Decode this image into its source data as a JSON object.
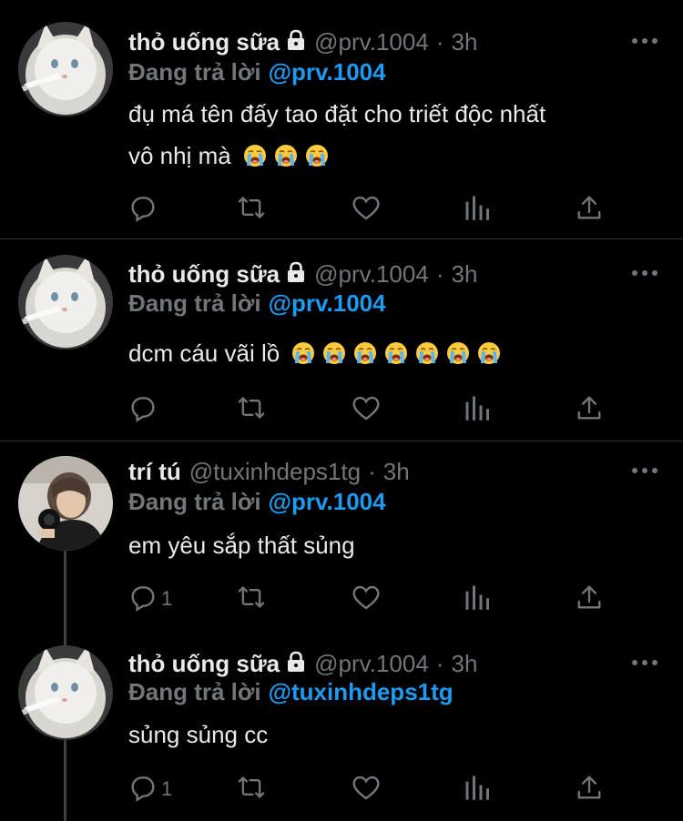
{
  "tweets": [
    {
      "name": "thỏ uống sữa",
      "locked": true,
      "handle": "@prv.1004",
      "dot": "·",
      "time": "3h",
      "reply_prefix": "Đang trả lời",
      "reply_to": "@prv.1004",
      "text_line1": "đụ má tên đấy tao đặt cho triết độc nhất",
      "text_line2": "vô nhị mà",
      "emoji_count": 3,
      "reply_count": "",
      "avatar": "white-cat-smoking"
    },
    {
      "name": "thỏ uống sữa",
      "locked": true,
      "handle": "@prv.1004",
      "dot": "·",
      "time": "3h",
      "reply_prefix": "Đang trả lời",
      "reply_to": "@prv.1004",
      "text_line1": "dcm cáu vãi lồ",
      "text_line2": "",
      "emoji_count": 7,
      "reply_count": "",
      "avatar": "white-cat-smoking"
    },
    {
      "name": "trí tú",
      "locked": false,
      "handle": "@tuxinhdeps1tg",
      "dot": "·",
      "time": "3h",
      "reply_prefix": "Đang trả lời",
      "reply_to": "@prv.1004",
      "text_line1": "em yêu sắp thất sủng",
      "text_line2": "",
      "emoji_count": 0,
      "reply_count": "1",
      "avatar": "person-with-camera"
    },
    {
      "name": "thỏ uống sữa",
      "locked": true,
      "handle": "@prv.1004",
      "dot": "·",
      "time": "3h",
      "reply_prefix": "Đang trả lời",
      "reply_to": "@tuxinhdeps1tg",
      "text_line1": "sủng sủng cc",
      "text_line2": "",
      "emoji_count": 0,
      "reply_count": "1",
      "avatar": "white-cat-smoking"
    }
  ],
  "icons": {
    "reply": "speech-bubble-icon",
    "retweet": "retweet-icon",
    "like": "heart-icon",
    "views": "bar-chart-icon",
    "share": "share-upload-icon",
    "more": "ellipsis-icon",
    "lock": "lock-icon",
    "emoji": "loudly-crying-face-emoji"
  },
  "colors": {
    "background": "#000000",
    "text": "#e7e9ea",
    "muted": "#71767b",
    "mention": "#1d9bf0",
    "divider": "#2f3336"
  }
}
